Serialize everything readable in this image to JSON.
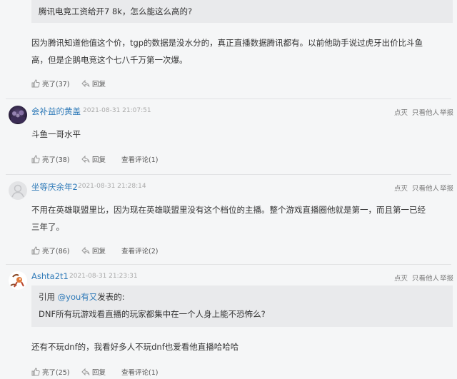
{
  "top_quote": {
    "text": "腾讯电竞工资给开7 8k，怎么能这么高的?"
  },
  "first_comment": {
    "body_lines": [
      "因为腾讯知道他值这个价，tgp的数据是没水分的，真正直播数据腾讯都有。以前他助手说过虎牙出价比斗鱼",
      "高，但是企鹅电竞这个七八千万第一次爆。"
    ],
    "like_label": "亮了(37)",
    "reply_label": "回复"
  },
  "comments": [
    {
      "username": "会补益的黄盖",
      "timestamp": "2021-08-31 21:07:51",
      "actions": [
        "点灭",
        "只看他人",
        "举报"
      ],
      "body_lines": [
        "斗鱼一哥水平"
      ],
      "like_label": "亮了(38)",
      "reply_label": "回复",
      "view_comments_label": "查看评论(1)"
    },
    {
      "username": "坐等庆余年2",
      "timestamp": "2021-08-31 21:28:14",
      "actions": [
        "点灭",
        "只看他人",
        "举报"
      ],
      "body_lines": [
        "不用在英雄联盟里比，因为现在英雄联盟里没有这个档位的主播。整个游戏直播圈他就是第一，而且第一已经",
        "三年了。"
      ],
      "like_label": "亮了(86)",
      "reply_label": "回复",
      "view_comments_label": "查看评论(2)"
    },
    {
      "username": "Ashta2t1",
      "timestamp": "2021-08-31 21:23:31",
      "actions": [
        "点灭",
        "只看他人",
        "举报"
      ],
      "quote": {
        "prefix": "引用 ",
        "mention": "@you有又",
        "suffix": "发表的:",
        "text": "DNF所有玩游戏看直播的玩家都集中在一个人身上能不恐怖么?"
      },
      "body_lines": [
        "还有不玩dnf的，我看好多人不玩dnf也爱看他直播哈哈哈"
      ],
      "like_label": "亮了(25)",
      "reply_label": "回复",
      "view_comments_label": "查看评论(1)"
    }
  ]
}
